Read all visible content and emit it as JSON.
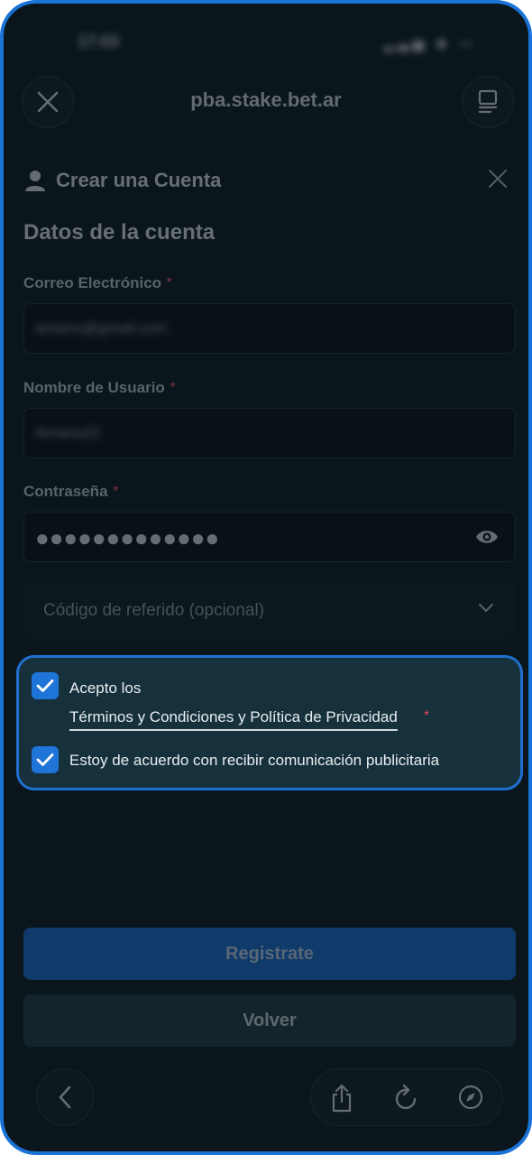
{
  "browser": {
    "url": "pba.stake.bet.ar",
    "status_time": "17:03",
    "status_icons": "▂▃▅ ◉ ▭"
  },
  "form": {
    "header_title": "Crear una Cuenta",
    "section_title": "Datos de la cuenta",
    "email": {
      "label": "Correo Electrónico",
      "required": "*",
      "value": "amanu@gmail.com"
    },
    "username": {
      "label": "Nombre de Usuario",
      "required": "*",
      "value": "Amanu22"
    },
    "password": {
      "label": "Contraseña",
      "required": "*",
      "value": "●●●●●●●●●●●●●"
    },
    "referral": {
      "placeholder": "Código de referido (opcional)"
    },
    "consent": {
      "accept_prefix": "Acepto los",
      "terms_link": "Términos y Condiciones y Política de Privacidad",
      "terms_required": "*",
      "marketing": "Estoy de acuerdo con recibir comunicación publicitaria",
      "accept_checked": true,
      "marketing_checked": true
    },
    "register_button": "Registrate",
    "back_button": "Volver"
  },
  "colors": {
    "accent": "#1f74d8",
    "background": "#0b161c",
    "required": "#d9475a"
  },
  "icons": [
    "close-icon",
    "reader-mode-icon",
    "user-icon",
    "eye-icon",
    "chevron-down-icon",
    "checkmark-icon",
    "back-arrow-icon",
    "share-icon",
    "reload-icon",
    "compass-icon"
  ]
}
